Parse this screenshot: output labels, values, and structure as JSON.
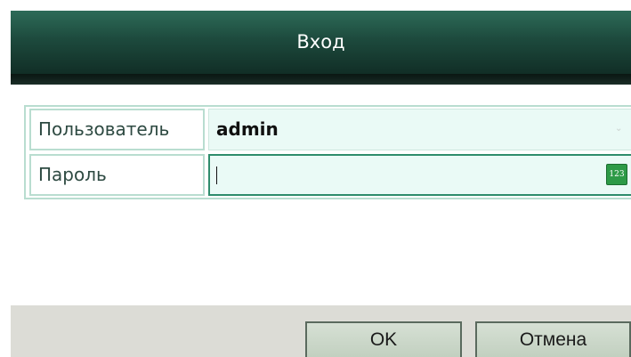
{
  "dialog": {
    "title": "Вход"
  },
  "form": {
    "user": {
      "label": "Пользователь",
      "value": "admin",
      "dropdown_icon": "chevron-down-icon"
    },
    "password": {
      "label": "Пароль",
      "value": "",
      "keyboard_badge": "123"
    }
  },
  "buttons": {
    "ok": "OK",
    "cancel": "Отмена"
  },
  "colors": {
    "titlebar": "#1d4a3d",
    "field_background": "#eafaf6",
    "border": "#b9ddd0",
    "focus_border": "#2e8c6c",
    "badge": "#2d9a47",
    "footer": "#dcdcd6"
  }
}
